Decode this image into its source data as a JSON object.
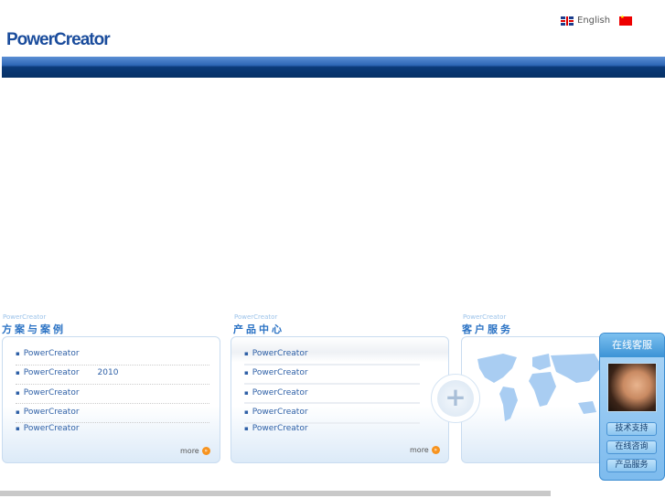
{
  "header": {
    "logo": "PowerCreator",
    "language": "English"
  },
  "sections": [
    {
      "sub": "PowerCreator",
      "title": "方案与案例",
      "items": [
        "PowerCreator",
        "PowerCreator       2010",
        "PowerCreator",
        "PowerCreator",
        "PowerCreator"
      ],
      "more": "more"
    },
    {
      "sub": "PowerCreator",
      "title": "产品中心",
      "items": [
        "PowerCreator",
        "PowerCreator",
        "PowerCreator",
        "PowerCreator",
        "PowerCreator"
      ],
      "more": "more"
    },
    {
      "sub": "PowerCreator",
      "title": "客户服务"
    }
  ],
  "service": {
    "title": "在线客服",
    "buttons": [
      "技术支持",
      "在线咨询",
      "产品服务"
    ]
  },
  "colors": {
    "accent": "#2a72c4",
    "nav": "#063166",
    "more": "#f7931e"
  }
}
